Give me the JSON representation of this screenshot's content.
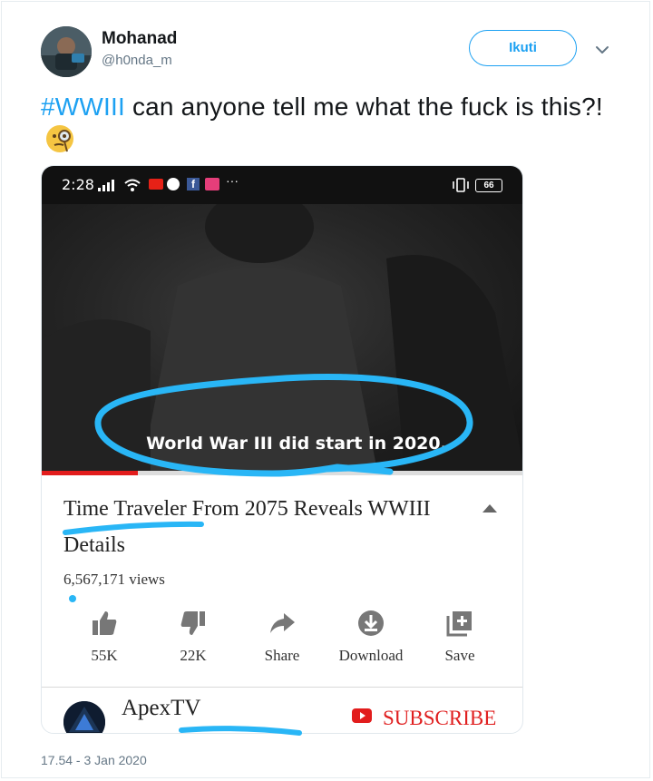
{
  "user": {
    "name": "Mohanad",
    "handle": "@h0nda_m",
    "follow_label": "Ikuti"
  },
  "tweet": {
    "hashtag": "#WWIII",
    "text": " can anyone tell me what the fuck is this?!",
    "emoji": "face-with-monocle",
    "timestamp": "17.54 - 3 Jan 2020"
  },
  "phone": {
    "time": "2:28",
    "battery": "66"
  },
  "video": {
    "subtitle": "World War III did start in 2020.",
    "progress": 0.2,
    "title": "Time Traveler From 2075 Reveals WWIII Details",
    "views": "6,567,171 views",
    "actions": [
      {
        "label": "55K",
        "icon": "thumbs-up-icon"
      },
      {
        "label": "22K",
        "icon": "thumbs-down-icon"
      },
      {
        "label": "Share",
        "icon": "share-icon"
      },
      {
        "label": "Download",
        "icon": "download-icon"
      },
      {
        "label": "Save",
        "icon": "save-to-playlist-icon"
      }
    ]
  },
  "channel": {
    "name": "ApexTV",
    "subscribe_label": "SUBSCRIBE"
  },
  "colors": {
    "accent": "#1da1f2",
    "annotation": "#29b6f6",
    "youtube_red": "#e21c1c"
  }
}
